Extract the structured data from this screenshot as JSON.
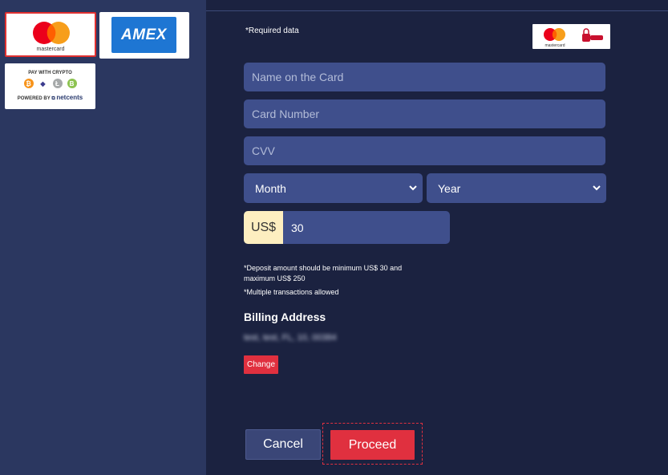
{
  "payment_methods": {
    "mastercard_label": "mastercard",
    "amex_label": "AMEX",
    "crypto_title": "PAY WITH CRYPTO",
    "crypto_powered_prefix": "POWERED BY",
    "crypto_powered_brand": "netcents"
  },
  "form": {
    "required_note": "*Required data",
    "badge_mastercard_label": "mastercard",
    "name_placeholder": "Name on the Card",
    "card_placeholder": "Card Number",
    "cvv_placeholder": "CVV",
    "month_selected": "Month",
    "year_selected": "Year",
    "currency": "US$",
    "amount_value": "30",
    "deposit_note_line1": "*Deposit amount should be minimum US$ 30 and",
    "deposit_note_line2": "maximum US$ 250",
    "multiple_note": "*Multiple transactions allowed",
    "billing_title": "Billing Address",
    "billing_value": "test, test, FL, 10, 00384",
    "change_label": "Change",
    "cancel_label": "Cancel",
    "proceed_label": "Proceed"
  },
  "colors": {
    "background": "#1b2240",
    "sidebar": "#2b3760",
    "field": "#3f4f8c",
    "accent_red": "#e0303f",
    "currency_bg": "#fdeec0"
  }
}
